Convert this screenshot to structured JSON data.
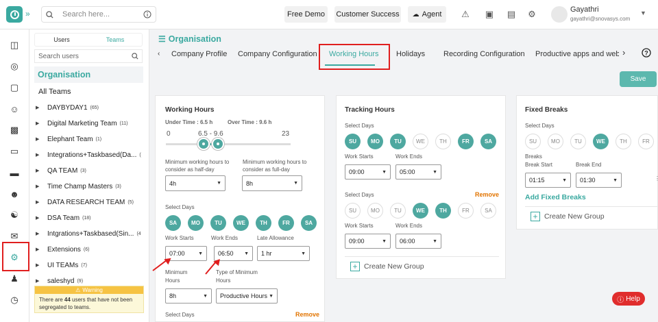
{
  "top": {
    "search_placeholder": "Search here...",
    "free_demo": "Free Demo",
    "customer_success": "Customer Success",
    "agent": "Agent",
    "user_name": "Gayathri",
    "user_email": "gayathri@snovasys.com"
  },
  "sidebar": {
    "tab_users": "Users",
    "tab_teams": "Teams",
    "search_placeholder": "Search users",
    "org": "Organisation",
    "all_teams": "All Teams",
    "teams": [
      {
        "name": "DAYBYDAY1",
        "count": "(65)"
      },
      {
        "name": "Digital Marketing Team",
        "count": "(11)"
      },
      {
        "name": "Elephant Team",
        "count": "(1)"
      },
      {
        "name": "Integrations+Taskbased(Da...",
        "count": "("
      },
      {
        "name": "QA TEAM",
        "count": "(3)"
      },
      {
        "name": "Time Champ Masters",
        "count": "(3)"
      },
      {
        "name": "DATA RESEARCH TEAM",
        "count": "(5)"
      },
      {
        "name": "DSA Team",
        "count": "(18)"
      },
      {
        "name": "Intgrations+Taskbased(Sin...",
        "count": "(4"
      },
      {
        "name": "Extensions",
        "count": "(6)"
      },
      {
        "name": "UI TEAMs",
        "count": "(7)"
      },
      {
        "name": "saleshyd",
        "count": "(9)"
      }
    ],
    "warning_title": "Warning",
    "warning_pre": "There are ",
    "warning_count": "44",
    "warning_post": " users that have not been segregated to teams."
  },
  "main": {
    "title": "Organisation",
    "tabs": [
      "Company Profile",
      "Company Configuration",
      "Working Hours",
      "Holidays",
      "Recording Configuration",
      "Productive apps and web"
    ],
    "save": "Save",
    "wh": {
      "title": "Working Hours",
      "under": "Under Time : 6.5 h",
      "over": "Over Time : 9.6 h",
      "min": "0",
      "range": "6.5 - 9.6",
      "max": "23",
      "halfday_label": "Minimum working hours to consider as half-day",
      "halfday": "4h",
      "fullday_label": "Minimum working hours to consider as full-day",
      "fullday": "8h",
      "select_days": "Select Days",
      "days": [
        "SA",
        "MO",
        "TU",
        "WE",
        "TH",
        "FR",
        "SA"
      ],
      "work_starts": "Work Starts",
      "work_ends": "Work Ends",
      "late": "Late Allowance",
      "start": "07:00",
      "end": "06:50",
      "late_val": "1 hr",
      "min_hours": "Minimum Hours",
      "type_min": "Type of Minimum Hours",
      "min_val": "8h",
      "type_val": "Productive Hours",
      "select_days2": "Select Days",
      "remove": "Remove"
    },
    "th": {
      "title": "Tracking Hours",
      "select_days": "Select Days",
      "days1": [
        {
          "d": "SU",
          "on": true
        },
        {
          "d": "MO",
          "on": true
        },
        {
          "d": "TU",
          "on": true
        },
        {
          "d": "WE",
          "on": false
        },
        {
          "d": "TH",
          "on": false
        },
        {
          "d": "FR",
          "on": true
        },
        {
          "d": "SA",
          "on": true
        }
      ],
      "work_starts": "Work Starts",
      "work_ends": "Work Ends",
      "start1": "09:00",
      "end1": "05:00",
      "select_days2": "Select Days",
      "remove": "Remove",
      "days2": [
        {
          "d": "SU",
          "on": false
        },
        {
          "d": "MO",
          "on": false
        },
        {
          "d": "TU",
          "on": false
        },
        {
          "d": "WE",
          "on": true
        },
        {
          "d": "TH",
          "on": true
        },
        {
          "d": "FR",
          "on": false
        },
        {
          "d": "SA",
          "on": false
        }
      ],
      "work_starts2": "Work Starts",
      "work_ends2": "Work Ends",
      "start2": "09:00",
      "end2": "06:00",
      "create": "Create New Group"
    },
    "fb": {
      "title": "Fixed Breaks",
      "select_days": "Select Days",
      "days": [
        {
          "d": "SU",
          "on": false
        },
        {
          "d": "MO",
          "on": false
        },
        {
          "d": "TU",
          "on": false
        },
        {
          "d": "WE",
          "on": true
        },
        {
          "d": "TH",
          "on": false
        },
        {
          "d": "FR",
          "on": false
        }
      ],
      "breaks": "Breaks",
      "break_start": "Break Start",
      "break_end": "Break End",
      "bs": "01:15",
      "be": "01:30",
      "add": "Add Fixed Breaks",
      "create": "Create New Group"
    }
  },
  "help": "Help"
}
